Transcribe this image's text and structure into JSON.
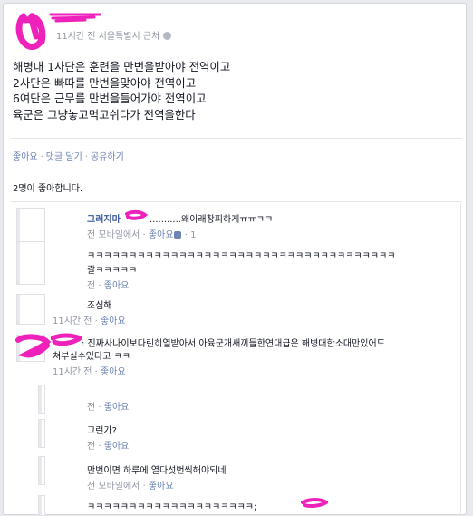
{
  "post": {
    "meta": "11시간 전 서울특별시 근처",
    "lines": [
      "해병대 1사단은 훈련을 만번을받아야 전역이고",
      "2사단은 빠따를 만번을맞아야 전역이고",
      "6여단은 근무를 만번을들어가야 전역이고",
      "육군은 그냥놓고먹고쉬다가 전역을한다"
    ]
  },
  "actions": {
    "like": "좋아요",
    "comment": "댓글 달기",
    "share": "공유하기",
    "separator": "·"
  },
  "likes_summary": "2명이 좋아합니다.",
  "comments": [
    {
      "name": "그러지마",
      "text": "...........왜이래창피하게ㅠㅠㅋㅋ",
      "meta_prefix": "전 모바일에서 · ",
      "meta_like": "좋아요",
      "meta_suffix": " · 1"
    },
    {
      "text_line1": "ㅋㅋㅋㅋㅋㅋㅋㅋㅋㅋㅋㅋㅋㅋㅋㅋㅋㅋㅋㅋㅋㅋㅋㅋㅋㅋㅋㅋㅋㅋㅋㅋㅋㅋㅋㅋㅋ",
      "text_line2": "갈ㅋㅋㅋㅋㅋ",
      "meta_prefix": "전 · ",
      "meta_like": "좋아요"
    },
    {
      "text": "조심해",
      "meta_prefix": "11시간 전 · ",
      "meta_like": "좋아요"
    },
    {
      "text_line1": ": 진짜사나이보다린히열받아서 아육군개새끼들한연대급은 해병대한소대만있어도",
      "text_line2": "쳐부실수있다고 ㅋㅋ",
      "meta_prefix": "11시간 전 · ",
      "meta_like": "좋아요"
    },
    {
      "meta_prefix": "전 · ",
      "meta_like": "좋아요"
    },
    {
      "text": "그런가?",
      "meta_prefix": "전 · ",
      "meta_like": "좋아요"
    },
    {
      "text": "만번이면 하루에 열다섯번씩해야되네",
      "meta_prefix": "전 모바일에서 · ",
      "meta_like": "좋아요"
    },
    {
      "text": "ㅋㅋㅋㅋㅋㅋㅋㅋㅋㅋㅋㅋㅋㅋㅋㅋㅋㅋㅋㅋ;"
    }
  ]
}
